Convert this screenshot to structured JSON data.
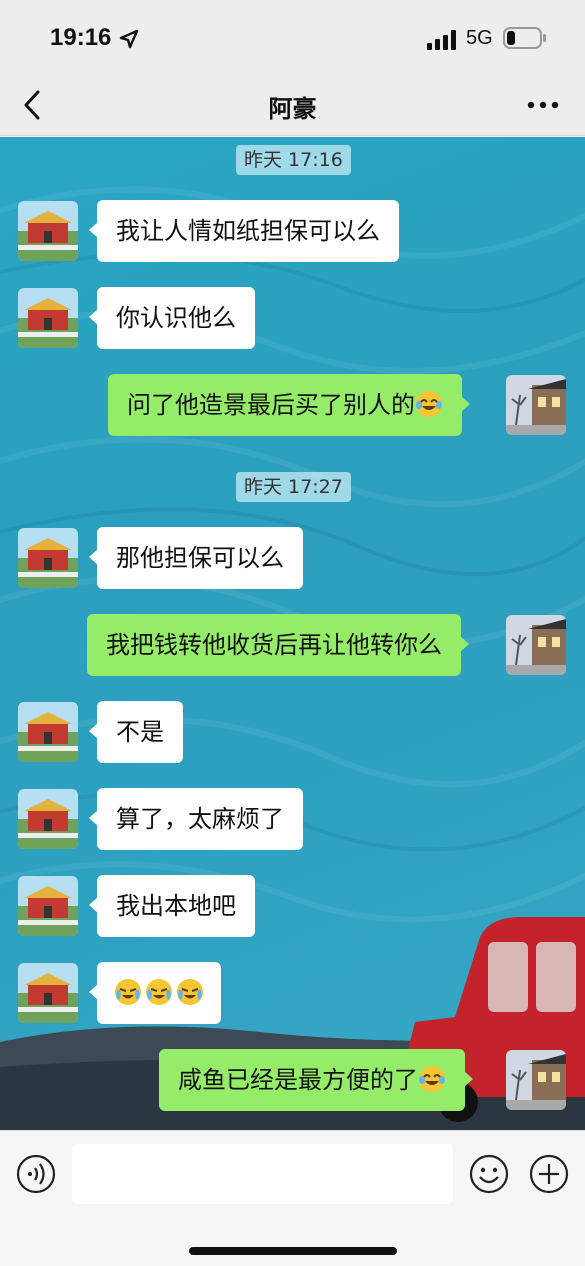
{
  "status_bar": {
    "time": "19:16",
    "network": "5G",
    "icons": [
      "location-arrow-icon",
      "signal-bars-icon",
      "battery-icon"
    ]
  },
  "nav": {
    "title": "阿豪",
    "back_icon": "chevron-left-icon",
    "more_icon": "more-dots-icon"
  },
  "chat": {
    "timestamps": [
      "昨天 17:16",
      "昨天 17:27"
    ],
    "messages": [
      {
        "side": "left",
        "text": "我让人情如纸担保可以么"
      },
      {
        "side": "left",
        "text": "你认识他么"
      },
      {
        "side": "right",
        "text": "问了他造景最后买了别人的",
        "emoji": "laugh-tears-emoji"
      },
      {
        "side": "left",
        "text": "那他担保可以么"
      },
      {
        "side": "right",
        "text": "我把钱转他收货后再让他转你么"
      },
      {
        "side": "left",
        "text": "不是"
      },
      {
        "side": "left",
        "text": "算了，太麻烦了"
      },
      {
        "side": "left",
        "text": "我出本地吧"
      },
      {
        "side": "left",
        "text": "",
        "emoji": "crying-laugh-emoji x3"
      },
      {
        "side": "right",
        "text": "咸鱼已经是最方便的了",
        "emoji": "laugh-tears-emoji"
      }
    ]
  },
  "input_bar": {
    "placeholder": "",
    "icons": [
      "voice-icon",
      "emoji-face-icon",
      "plus-icon"
    ]
  },
  "colors": {
    "bubble_right": "#95ec69",
    "bubble_left": "#ffffff",
    "chat_background": "#2ba3c2"
  }
}
